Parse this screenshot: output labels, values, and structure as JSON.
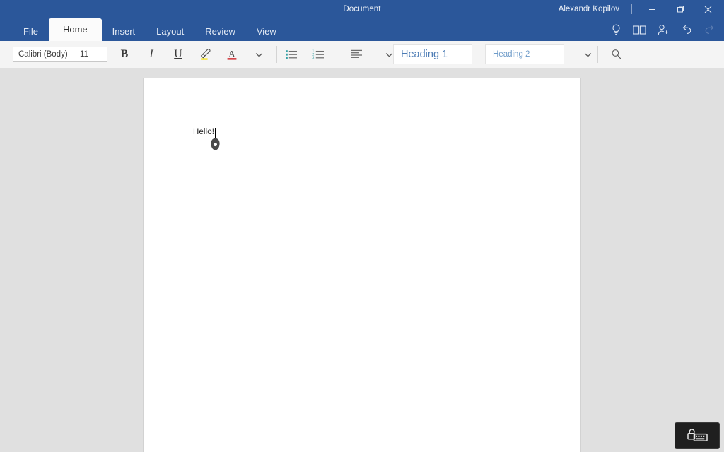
{
  "window": {
    "document_title": "Document",
    "user_name": "Alexandr Kopilov",
    "controls": {
      "minimize": "minimize-button",
      "restore": "restore-button",
      "close": "close-button"
    },
    "accent_color": "#2b579a",
    "titlebar_text_color": "#eef2f8"
  },
  "ribbon": {
    "tabs": [
      {
        "label": "File",
        "active": false
      },
      {
        "label": "Home",
        "active": true
      },
      {
        "label": "Insert",
        "active": false
      },
      {
        "label": "Layout",
        "active": false
      },
      {
        "label": "Review",
        "active": false
      },
      {
        "label": "View",
        "active": false
      }
    ],
    "quick_icons": [
      {
        "name": "lightbulb-icon",
        "label": "Tell me",
        "enabled": true
      },
      {
        "name": "read-mode-icon",
        "label": "Read Mode",
        "enabled": true
      },
      {
        "name": "share-person-icon",
        "label": "Share",
        "enabled": true
      },
      {
        "name": "undo-icon",
        "label": "Undo",
        "enabled": true
      },
      {
        "name": "redo-icon",
        "label": "Redo",
        "enabled": false
      }
    ]
  },
  "toolbar": {
    "font_name": "Calibri (Body)",
    "font_size": "11",
    "bold_label": "B",
    "italic_label": "I",
    "underline_label": "U",
    "highlight_icon": "highlighter-icon",
    "highlight_color": "#f5e21a",
    "font_color_icon": "font-color-icon",
    "font_color": "#d13438",
    "font_more_icon": "chevron-down-icon",
    "bullet_list_icon": "bullet-list-icon",
    "numbered_list_icon": "numbered-list-icon",
    "align_icon": "align-left-icon",
    "list_marker_color": "#34a0a4",
    "paragraph_more_icon": "chevron-down-icon",
    "styles": [
      {
        "label": "Heading 1",
        "color": "#4d7cb5"
      },
      {
        "label": "Heading 2",
        "color": "#6e9bc9"
      }
    ],
    "styles_more_icon": "chevron-down-icon",
    "search_icon": "search-icon"
  },
  "document": {
    "body_text": "Hello!",
    "caret_visible": true,
    "selection_handle_icon": "text-selection-handle-icon",
    "page_background": "#ffffff",
    "canvas_background": "#e0e0e0"
  },
  "overlay": {
    "touch_keyboard_icon": "touch-keyboard-icon",
    "background": "#1f1f1f"
  }
}
